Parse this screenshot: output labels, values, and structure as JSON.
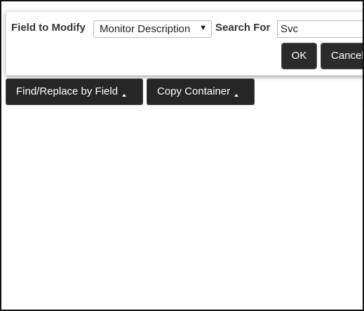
{
  "dialog": {
    "field_label": "Field to Modify",
    "field_value": "Monitor Description",
    "search_label": "Search For",
    "search_value": "Svc",
    "ok_label": "OK",
    "cancel_label": "Cancel"
  },
  "toolbar": {
    "find_replace_label": "Find/Replace by Field",
    "copy_container_label": "Copy Container"
  },
  "icons": {
    "select_arrow": "chevron-down-icon",
    "menu_caret": "caret-up-icon"
  },
  "colors": {
    "button_bg": "#262626",
    "button_text": "#ffffff",
    "label_text": "#333333"
  }
}
